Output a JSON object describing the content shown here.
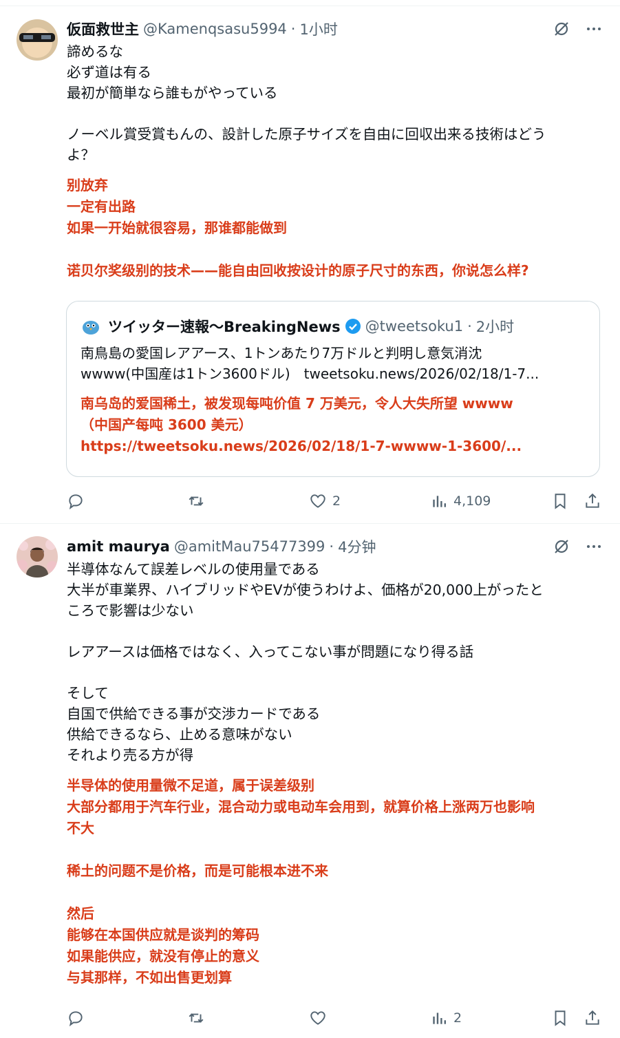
{
  "tweets": [
    {
      "name": "仮面救世主",
      "handle": "@Kamenqsasu5994",
      "time": "1小时",
      "lines": [
        "諦めるな",
        "必ず道は有る",
        "最初が簡単なら誰もがやっている",
        "",
        "ノーベル賞受賞もんの、設計した原子サイズを自由に回収出来る技術はどう",
        "よ？"
      ],
      "translation": [
        "别放弃",
        "一定有出路",
        "如果一开始就很容易，那谁都能做到",
        "",
        "诺贝尔奖级别的技术——能自由回收按设计的原子尺寸的东西，你说怎么样?"
      ],
      "quote": {
        "name": "ツイッター速報〜BreakingNews",
        "handle": "@tweetsoku1",
        "time": "2小时",
        "lines": [
          "南鳥島の愛国レアアース、1トンあたり7万ドルと判明し意気消沈",
          "wwww(中国産は1トン3600ドル)　tweetsoku.news/2026/02/18/1-7..."
        ],
        "translation": [
          "南乌岛的爱国稀土，被发现每吨价值 7 万美元，令人大失所望 wwww",
          "（中国产每吨 3600 美元）",
          "https://tweetsoku.news/2026/02/18/1-7-wwww-1-3600/..."
        ]
      },
      "likes": "2",
      "views": "4,109"
    },
    {
      "name": "amit maurya",
      "handle": "@amitMau75477399",
      "time": "4分钟",
      "lines": [
        "半導体なんて誤差レベルの使用量である",
        "大半が車業界、ハイブリッドやEVが使うわけよ、価格が20,000上がったと",
        "ころで影響は少ない",
        "",
        "レアアースは価格ではなく、入ってこない事が問題になり得る話",
        "",
        "そして",
        "自国で供給できる事が交渉カードである",
        "供給できるなら、止める意味がない",
        "それより売る方が得"
      ],
      "translation": [
        "半导体的使用量微不足道，属于误差级别",
        "大部分都用于汽车行业，混合动力或电动车会用到，就算价格上涨两万也影响",
        "不大",
        "",
        "稀土的问题不是价格，而是可能根本进不来",
        "",
        "然后",
        "能够在本国供应就是谈判的筹码",
        "如果能供应，就没有停止的意义",
        "与其那样，不如出售更划算"
      ],
      "views": "2"
    }
  ],
  "icons": [
    "grok-icon",
    "more-icon",
    "reply-icon",
    "retweet-icon",
    "like-icon",
    "views-icon",
    "bookmark-icon",
    "share-icon"
  ]
}
